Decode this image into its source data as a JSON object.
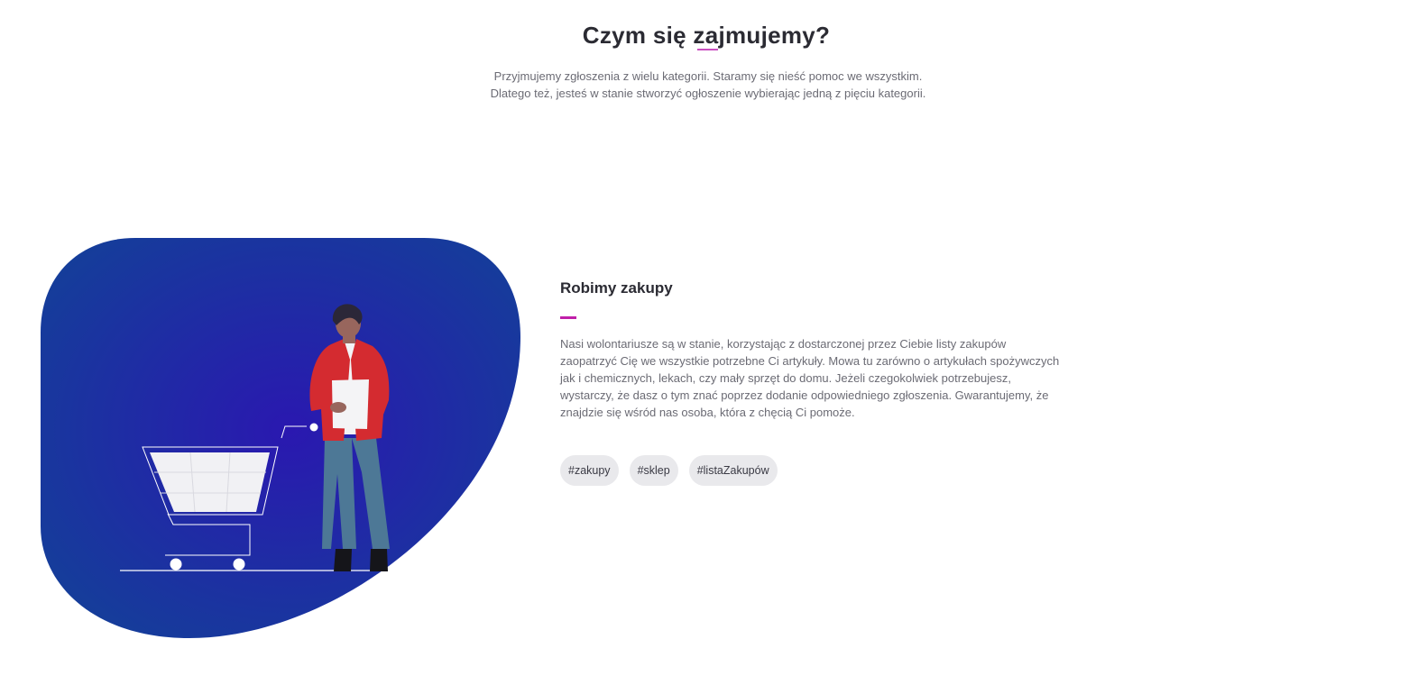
{
  "section": {
    "title": "Czym się zajmujemy?",
    "lead": "Przyjmujemy zgłoszenia z wielu kategorii. Staramy się nieść pomoc we wszystkim. Dlatego też, jesteś w stanie stworzyć ogłoszenie wybierając jedną z pięciu kategorii."
  },
  "feature": {
    "title": "Robimy zakupy",
    "body": "Nasi wolontariusze są w stanie, korzystając z dostarczonej przez Ciebie listy zakupów zaopatrzyć Cię we wszystkie potrzebne Ci artykuły. Mowa tu zarówno o artykułach spożywczych jak i chemicznych, lekach, czy mały sprzęt do domu. Jeżeli czegokolwiek potrzebujesz, wystarczy, że dasz o tym znać poprzez dodanie odpowiedniego zgłoszenia. Gwarantujemy, że znajdzie się wśród nas osoba, która z chęcią Ci pomoże.",
    "tags": [
      "#zakupy",
      "#sklep",
      "#listaZakupów"
    ],
    "illustration": "shopping-cart-person-illustration"
  },
  "colors": {
    "accent": "#c94fc0",
    "blob_center": "#2a18b0",
    "blob_edge": "#153d9a",
    "tag_bg": "#e9e9ec"
  }
}
